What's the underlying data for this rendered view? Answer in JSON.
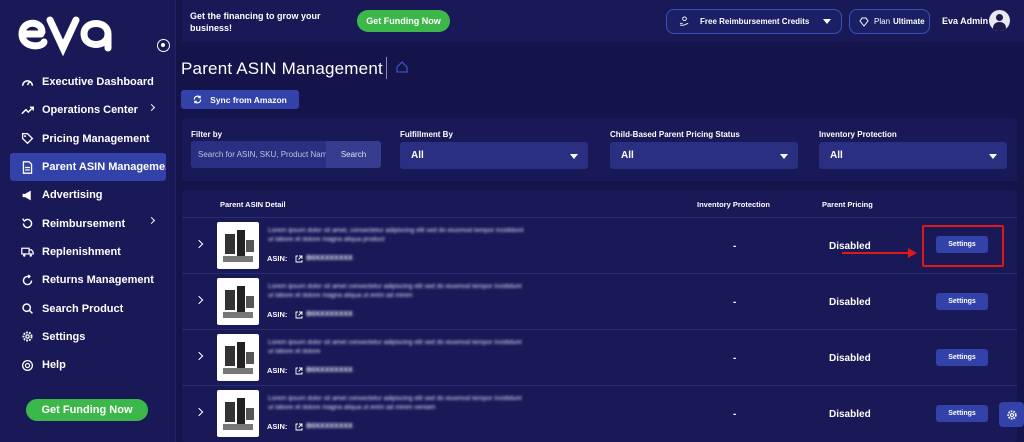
{
  "app": {
    "logo_text": "eva"
  },
  "sidebar": {
    "items": [
      {
        "label": "Executive Dashboard",
        "icon": "gauge-icon",
        "chevron": false,
        "active": false
      },
      {
        "label": "Operations Center",
        "icon": "trend-up-icon",
        "chevron": true,
        "active": false
      },
      {
        "label": "Pricing Management",
        "icon": "price-tag-icon",
        "chevron": false,
        "active": false
      },
      {
        "label": "Parent ASIN Manageme...",
        "icon": "document-icon",
        "chevron": false,
        "active": true
      },
      {
        "label": "Advertising",
        "icon": "megaphone-icon",
        "chevron": false,
        "active": false
      },
      {
        "label": "Reimbursement",
        "icon": "refund-icon",
        "chevron": true,
        "active": false
      },
      {
        "label": "Replenishment",
        "icon": "truck-icon",
        "chevron": false,
        "active": false
      },
      {
        "label": "Returns Management",
        "icon": "return-icon",
        "chevron": false,
        "active": false
      },
      {
        "label": "Search Product",
        "icon": "search-icon",
        "chevron": false,
        "active": false
      },
      {
        "label": "Settings",
        "icon": "gear-icon",
        "chevron": false,
        "active": false
      },
      {
        "label": "Help",
        "icon": "lifebuoy-icon",
        "chevron": false,
        "active": false
      }
    ],
    "funding_button": "Get Funding Now"
  },
  "topbar": {
    "promo_text": "Get the financing to grow your business!",
    "funding_button": "Get Funding Now",
    "credits_label": "Free Reimbursement Credits",
    "plan_prefix": "Plan",
    "plan_name": "Ultimate",
    "user_name": "Eva Admin"
  },
  "page": {
    "title": "Parent ASIN Management",
    "sync_button": "Sync from Amazon"
  },
  "filters": {
    "filter_by_label": "Filter by",
    "search_placeholder": "Search for ASIN, SKU, Product Name",
    "search_button": "Search",
    "fulfillment_label": "Fulfillment By",
    "fulfillment_value": "All",
    "child_pricing_label": "Child-Based Parent Pricing Status",
    "child_pricing_value": "All",
    "inventory_protection_label": "Inventory Protection",
    "inventory_protection_value": "All"
  },
  "table": {
    "headers": {
      "detail": "Parent ASIN Detail",
      "inventory": "Inventory Protection",
      "pricing": "Parent Pricing"
    },
    "rows": [
      {
        "title": "Lorem ipsum dolor sit amet, consectetur adipiscing elit sed do eiusmod tempor incididunt ut labore et dolore magna aliqua product",
        "asin_label": "ASIN:",
        "asin": "B0XXXXXXXX",
        "inventory": "-",
        "pricing": "Disabled",
        "settings": "Settings"
      },
      {
        "title": "Lorem ipsum dolor sit amet consectetur adipiscing elit sed do eiusmod tempor incididunt ut labore et dolore magna aliqua ut enim ad minim",
        "asin_label": "ASIN:",
        "asin": "B0XXXXXXXX",
        "inventory": "-",
        "pricing": "Disabled",
        "settings": "Settings"
      },
      {
        "title": "Lorem ipsum dolor sit amet consectetur adipiscing elit sed do eiusmod tempor incididunt ut labore et dolore",
        "asin_label": "ASIN:",
        "asin": "B0XXXXXXXX",
        "inventory": "-",
        "pricing": "Disabled",
        "settings": "Settings"
      },
      {
        "title": "Lorem ipsum dolor sit amet consectetur adipiscing elit sed do eiusmod tempor incididunt ut labore et dolore magna aliqua ut enim ad minim veniam",
        "asin_label": "ASIN:",
        "asin": "B0XXXXXXXX",
        "inventory": "-",
        "pricing": "Disabled",
        "settings": "Settings"
      }
    ]
  },
  "colors": {
    "background": "#14144a",
    "panel": "#191958",
    "accent": "#3242a8",
    "green": "#3cb84a",
    "highlight": "#e01818"
  }
}
